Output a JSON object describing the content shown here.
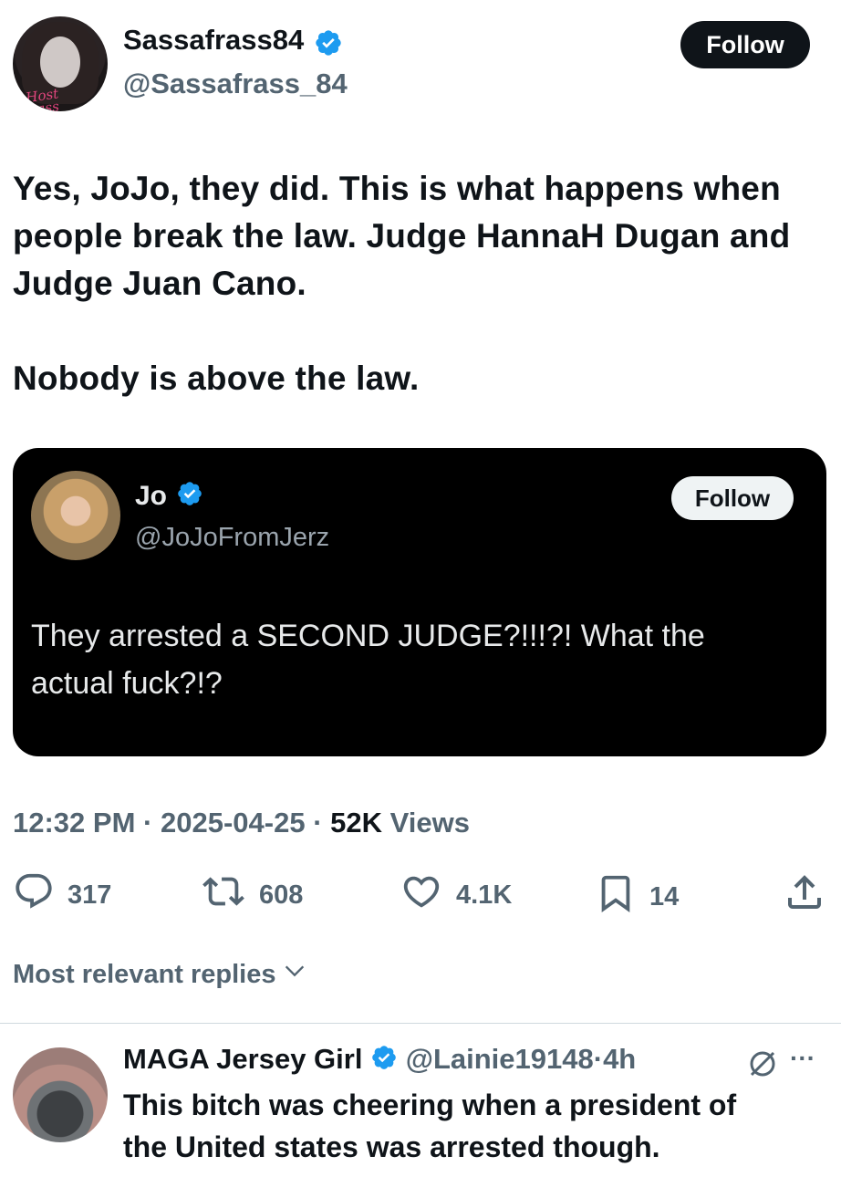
{
  "author": {
    "display_name": "Sassafrass84",
    "handle": "@Sassafrass_84",
    "avatar_caption": "Host of the Sass Saloon"
  },
  "follow_label": "Follow",
  "tweet": {
    "line1": "Yes, JoJo, they did. This is what happens when",
    "line2": "people break the law. Judge HannaH Dugan and",
    "line3": "Judge Juan Cano.",
    "line4": "Nobody is above the law."
  },
  "quote": {
    "display_name": "Jo",
    "handle": "@JoJoFromJerz",
    "follow_label": "Follow",
    "line1": "They arrested a SECOND JUDGE?!!!?! What the",
    "line2": "actual fuck?!?"
  },
  "meta": {
    "time": "12:32 PM",
    "date": "2025-04-25",
    "views_count": "52K",
    "views_label": "Views",
    "separator": "·"
  },
  "actions": {
    "replies": "317",
    "reposts": "608",
    "likes": "4.1K",
    "bookmarks": "14"
  },
  "replies_sort_label": "Most relevant replies",
  "reply": {
    "display_name": "MAGA Jersey Girl",
    "handle": "@Lainie19148",
    "age": "4h",
    "separator": "·",
    "more": "···",
    "line1": "This bitch was cheering when a president of",
    "line2": "the United states was arrested though."
  },
  "colors": {
    "verified_blue": "#1d9bf0",
    "secondary_text": "#536471",
    "primary_text": "#0f1419"
  }
}
